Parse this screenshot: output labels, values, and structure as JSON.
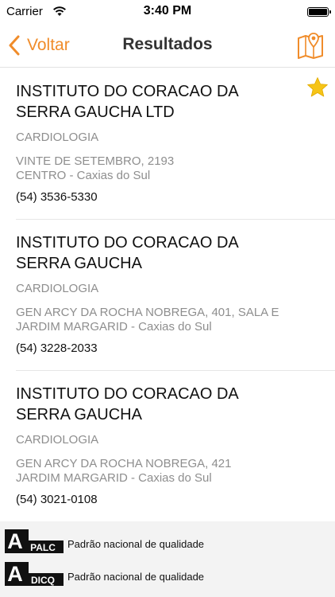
{
  "status_bar": {
    "carrier": "Carrier",
    "time": "3:40 PM"
  },
  "nav": {
    "back_label": "Voltar",
    "title": "Resultados"
  },
  "colors": {
    "accent": "#f08c2a",
    "star": "#f6c417"
  },
  "results": [
    {
      "name": "INSTITUTO DO CORACAO DA SERRA GAUCHA LTD",
      "specialty": "CARDIOLOGIA",
      "address_line1": "VINTE DE SETEMBRO, 2193",
      "address_line2": "CENTRO - Caxias do Sul",
      "phone": "(54) 3536-5330",
      "favorite": true
    },
    {
      "name": "INSTITUTO DO CORACAO DA SERRA GAUCHA",
      "specialty": "CARDIOLOGIA",
      "address_line1": "GEN ARCY DA ROCHA NOBREGA, 401, SALA E",
      "address_line2": "JARDIM MARGARID - Caxias do Sul",
      "phone": "(54) 3228-2033",
      "favorite": false
    },
    {
      "name": "INSTITUTO DO CORACAO DA SERRA GAUCHA",
      "specialty": "CARDIOLOGIA",
      "address_line1": "GEN ARCY DA ROCHA NOBREGA, 421",
      "address_line2": "JARDIM MARGARID - Caxias do Sul",
      "phone": "(54) 3021-0108",
      "favorite": false
    }
  ],
  "legend": [
    {
      "badge_letter": "A",
      "badge_code": "PALC",
      "text": "Padrão nacional de qualidade"
    },
    {
      "badge_letter": "A",
      "badge_code": "DICQ",
      "text": "Padrão nacional de qualidade"
    }
  ]
}
